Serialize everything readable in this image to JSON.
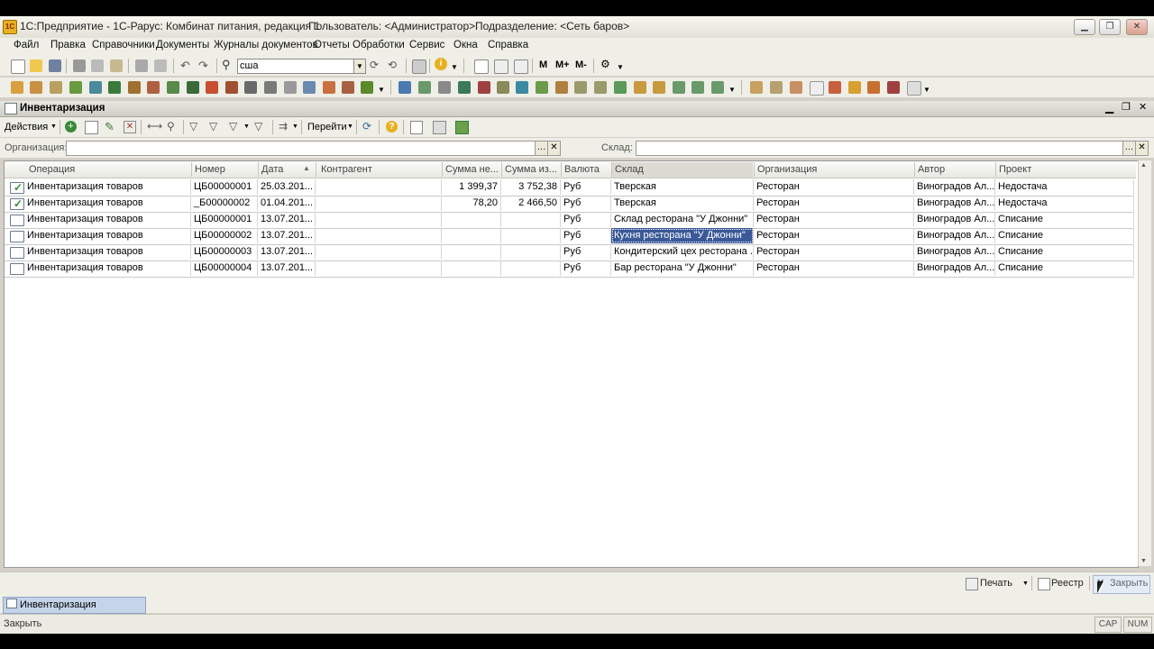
{
  "window": {
    "title": "1С:Предприятие - 1С-Рарус: Комбинат питания, редакция 1",
    "user": "Пользователь: <Администратор>",
    "division": "Подразделение: <Сеть баров>"
  },
  "menu": [
    "Файл",
    "Правка",
    "Справочники",
    "Документы",
    "Журналы документов",
    "Отчеты",
    "Обработки",
    "Сервис",
    "Окна",
    "Справка"
  ],
  "toolbar": {
    "search_value": "сша",
    "m_label": "M",
    "m_plus_label": "M+",
    "m_minus_label": "M-"
  },
  "document": {
    "title": "Инвентаризация",
    "actions_label": "Действия",
    "goto_label": "Перейти",
    "org_label": "Организация:",
    "org_value": "",
    "warehouse_label": "Склад:",
    "warehouse_value": ""
  },
  "grid": {
    "columns": [
      "Операция",
      "Номер",
      "Дата",
      "Контрагент",
      "Сумма не...",
      "Сумма из...",
      "Валюта",
      "Склад",
      "Организация",
      "Автор",
      "Проект"
    ],
    "rows": [
      {
        "status": "posted",
        "op": "Инвентаризация товаров",
        "num": "ЦБ00000001",
        "date": "25.03.201...",
        "counterparty": "",
        "sum1": "1 399,37",
        "sum2": "3 752,38",
        "cur": "Руб",
        "warehouse": "Тверская",
        "org": "Ресторан",
        "author": "Виноградов Ал...",
        "project": "Недостача"
      },
      {
        "status": "posted",
        "op": "Инвентаризация товаров",
        "num": "_Б00000002",
        "date": "01.04.201...",
        "counterparty": "",
        "sum1": "78,20",
        "sum2": "2 466,50",
        "cur": "Руб",
        "warehouse": "Тверская",
        "org": "Ресторан",
        "author": "Виноградов Ал...",
        "project": "Недостача"
      },
      {
        "status": "draft",
        "op": "Инвентаризация товаров",
        "num": "ЦБ00000001",
        "date": "13.07.201...",
        "counterparty": "",
        "sum1": "",
        "sum2": "",
        "cur": "Руб",
        "warehouse": "Склад ресторана \"У Джонни\"",
        "org": "Ресторан",
        "author": "Виноградов Ал...",
        "project": "Списание"
      },
      {
        "status": "draft",
        "op": "Инвентаризация товаров",
        "num": "ЦБ00000002",
        "date": "13.07.201...",
        "counterparty": "",
        "sum1": "",
        "sum2": "",
        "cur": "Руб",
        "warehouse": "Кухня ресторана \"У Джонни\"",
        "org": "Ресторан",
        "author": "Виноградов Ал...",
        "project": "Списание"
      },
      {
        "status": "draft",
        "op": "Инвентаризация товаров",
        "num": "ЦБ00000003",
        "date": "13.07.201...",
        "counterparty": "",
        "sum1": "",
        "sum2": "",
        "cur": "Руб",
        "warehouse": "Кондитерский цех ресторана ...",
        "org": "Ресторан",
        "author": "Виноградов Ал...",
        "project": "Списание"
      },
      {
        "status": "draft",
        "op": "Инвентаризация товаров",
        "num": "ЦБ00000004",
        "date": "13.07.201...",
        "counterparty": "",
        "sum1": "",
        "sum2": "",
        "cur": "Руб",
        "warehouse": "Бар ресторана \"У Джонни\"",
        "org": "Ресторан",
        "author": "Виноградов Ал...",
        "project": "Списание"
      }
    ]
  },
  "bottom": {
    "print_label": "Печать",
    "registry_label": "Реестр",
    "close_label": "Закрыть"
  },
  "taskbar": {
    "tab_label": "Инвентаризация"
  },
  "status": {
    "text": "Закрыть",
    "caps": "CAP",
    "num": "NUM"
  },
  "colors": {
    "selection": "#3b5998",
    "accent": "#e8b020"
  }
}
